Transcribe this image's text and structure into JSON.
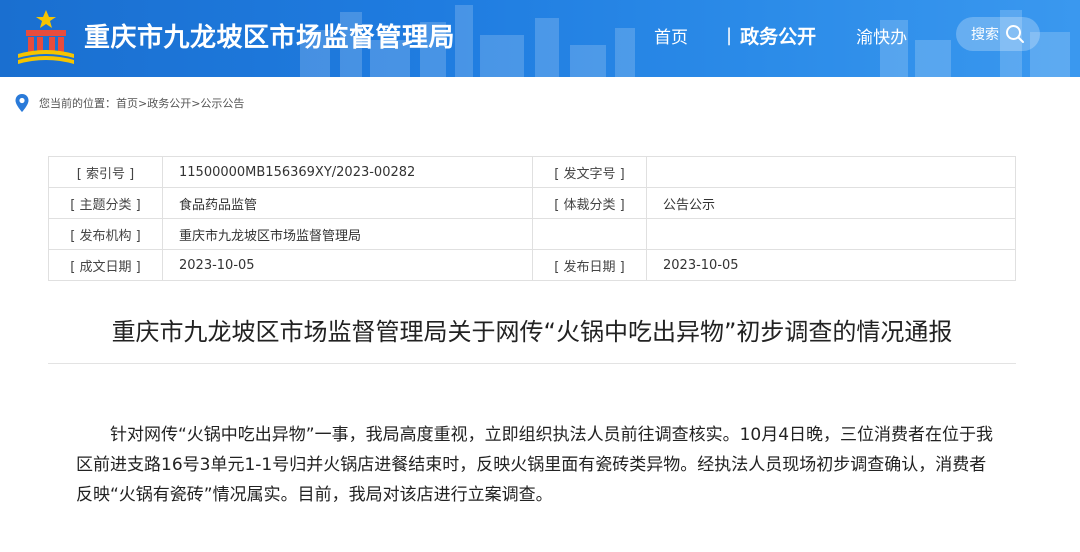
{
  "header": {
    "site_title": "重庆市九龙坡区市场监督管理局",
    "logo_icon": "gov-emblem-icon",
    "nav": {
      "home": "首页",
      "separator": "|",
      "gov_open": "政务公开",
      "fast_service": "渝快办"
    },
    "search_label": "搜索",
    "colors": {
      "bar": "#1f7ce0",
      "text": "#ffffff"
    }
  },
  "breadcrumb": {
    "prefix": "您当前的位置：",
    "items": [
      "首页",
      " >政务公开",
      " >公示公告"
    ]
  },
  "info": {
    "index_no_label": "[ 索引号 ]",
    "index_no": "11500000MB156369XY/2023-00282",
    "doc_no_label": "[ 发文字号 ]",
    "doc_no": "",
    "subject_label": "[ 主题分类 ]",
    "subject": "食品药品监管",
    "genre_label": "[ 体裁分类 ]",
    "genre": "公告公示",
    "publisher_label": "[ 发布机构 ]",
    "publisher": "重庆市九龙坡区市场监督管理局",
    "written_date_label": "[ 成文日期 ]",
    "written_date": "2023-10-05",
    "publish_date_label": "[ 发布日期 ]",
    "publish_date": "2023-10-05"
  },
  "article": {
    "title": "重庆市九龙坡区市场监督管理局关于网传“火锅中吃出异物”初步调查的情况通报",
    "body": "针对网传“火锅中吃出异物”一事，我局高度重视，立即组织执法人员前往调查核实。10月4日晚，三位消费者在位于我区前进支路16号3单元1-1号归并火锅店进餐结束时，反映火锅里面有瓷砖类异物。经执法人员现场初步调查确认，消费者反映“火锅有瓷砖”情况属实。目前，我局对该店进行立案调查。"
  }
}
